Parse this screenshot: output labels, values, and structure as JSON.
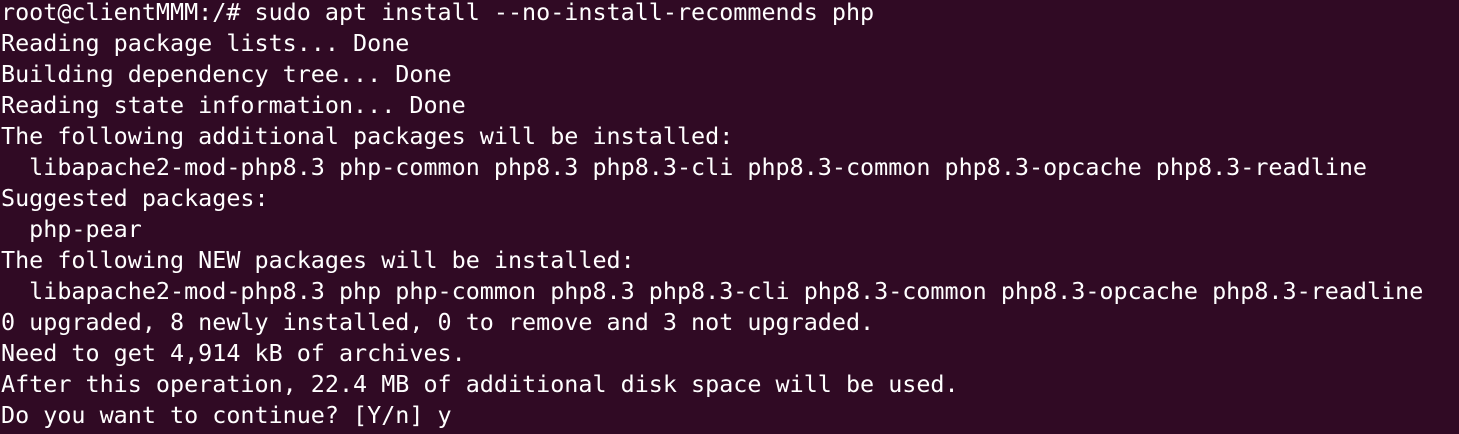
{
  "terminal": {
    "lines": [
      "root@clientMMM:/# sudo apt install --no-install-recommends php",
      "Reading package lists... Done",
      "Building dependency tree... Done",
      "Reading state information... Done",
      "The following additional packages will be installed:",
      "  libapache2-mod-php8.3 php-common php8.3 php8.3-cli php8.3-common php8.3-opcache php8.3-readline",
      "Suggested packages:",
      "  php-pear",
      "The following NEW packages will be installed:",
      "  libapache2-mod-php8.3 php php-common php8.3 php8.3-cli php8.3-common php8.3-opcache php8.3-readline",
      "0 upgraded, 8 newly installed, 0 to remove and 3 not upgraded.",
      "Need to get 4,914 kB of archives.",
      "After this operation, 22.4 MB of additional disk space will be used.",
      "Do you want to continue? [Y/n] y"
    ],
    "colors": {
      "background": "#300a24",
      "foreground": "#ffffff"
    }
  }
}
